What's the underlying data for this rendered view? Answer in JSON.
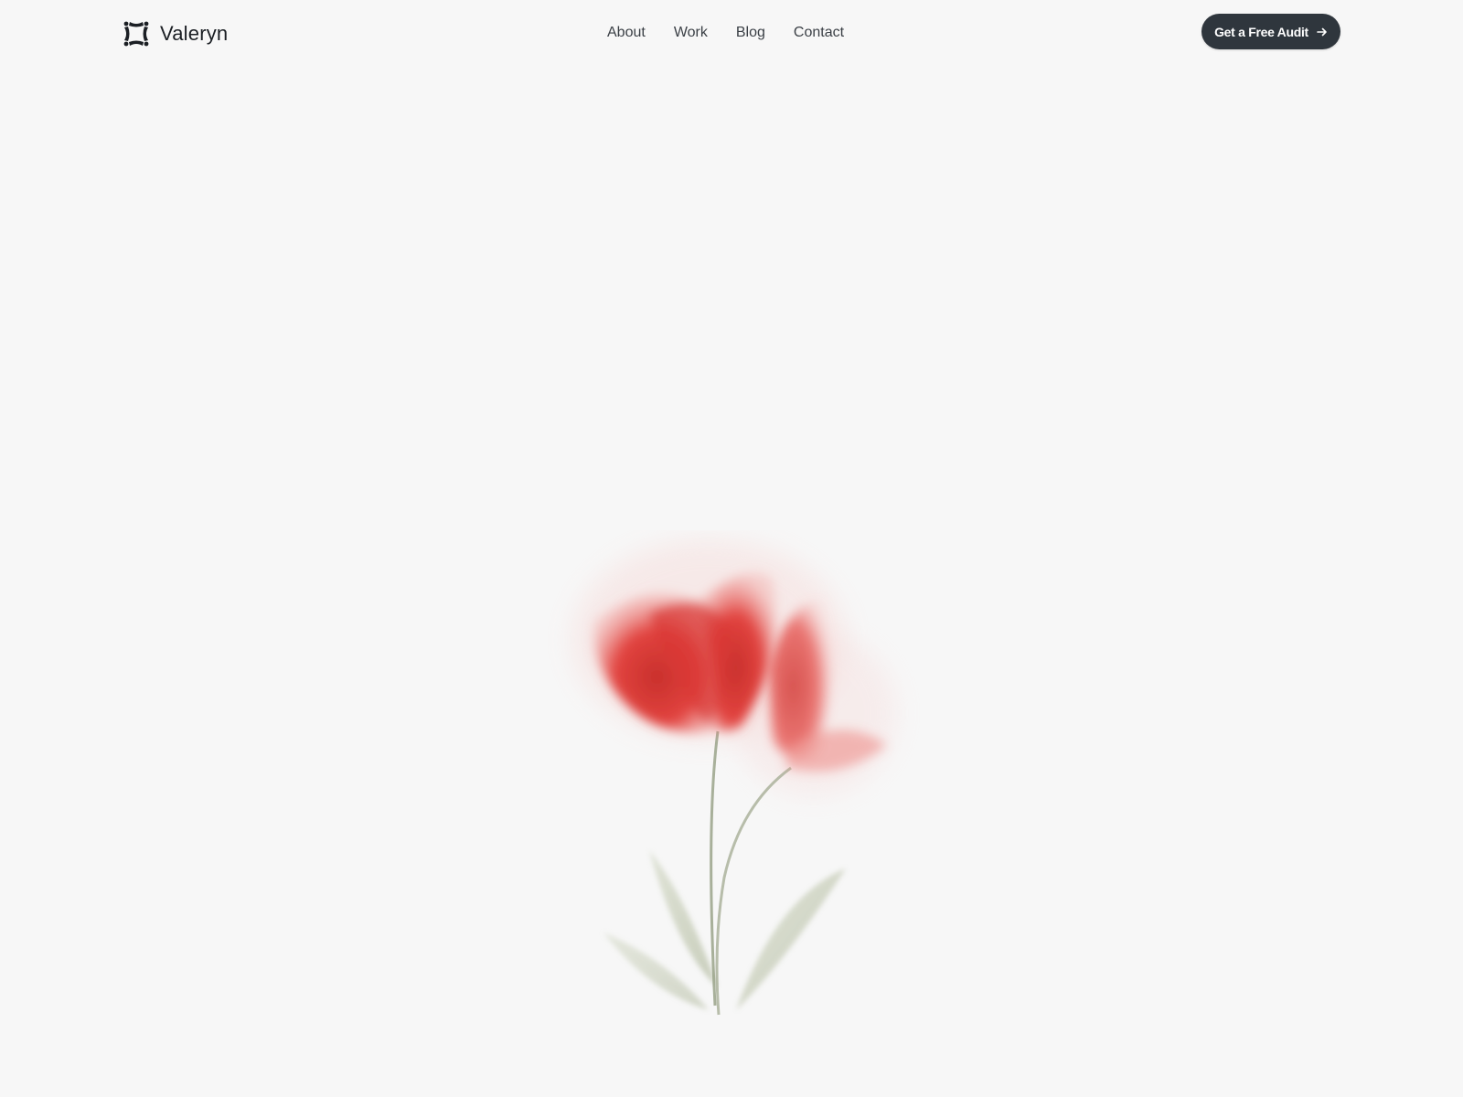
{
  "brand": {
    "name": "Valeryn",
    "icon": "logo-mark-icon"
  },
  "nav": {
    "items": [
      {
        "label": "About"
      },
      {
        "label": "Work"
      },
      {
        "label": "Blog"
      },
      {
        "label": "Contact"
      }
    ]
  },
  "cta": {
    "label": "Get a Free Audit",
    "icon": "arrow-right-icon",
    "background": "#2f363d"
  },
  "hero": {
    "illustration": "tulip-flowers-icon",
    "petal_color": "#e2433f",
    "stem_color": "#9aa38a"
  }
}
